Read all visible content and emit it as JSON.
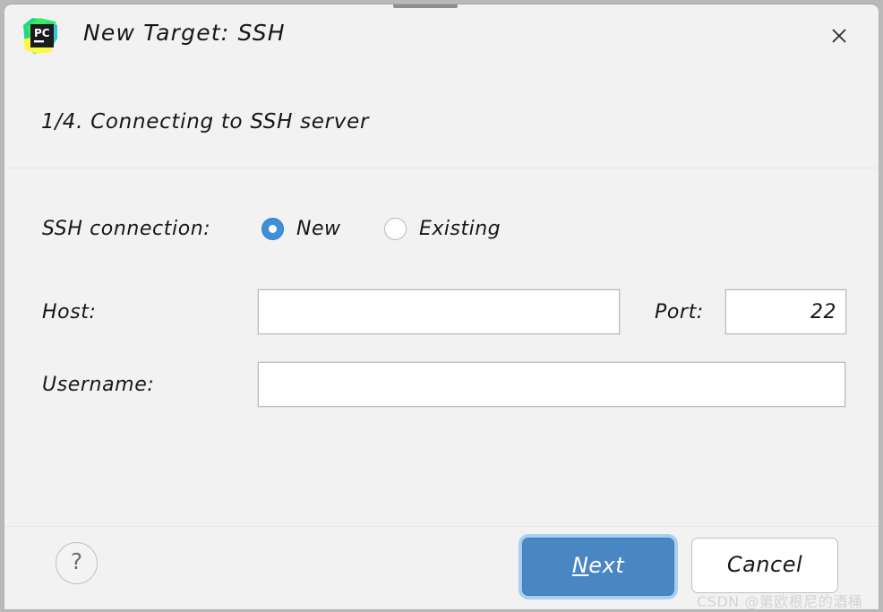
{
  "window": {
    "title": "New Target: SSH",
    "app_icon": "pycharm-icon",
    "close_icon": "close-icon"
  },
  "step": {
    "text": "1/4. Connecting to SSH server"
  },
  "form": {
    "connection": {
      "label": "SSH connection:",
      "options": [
        {
          "label": "New",
          "selected": true
        },
        {
          "label": "Existing",
          "selected": false
        }
      ]
    },
    "host": {
      "label": "Host:",
      "value": "",
      "placeholder": ""
    },
    "port": {
      "label": "Port:",
      "value": "22",
      "placeholder": ""
    },
    "username": {
      "label": "Username:",
      "value": "",
      "placeholder": ""
    }
  },
  "footer": {
    "help_label": "?",
    "next_label_mnemonic": "N",
    "next_label_rest": "ext",
    "cancel_label": "Cancel"
  },
  "watermark": {
    "text": "CSDN @第欧根尼的酒桶"
  },
  "colors": {
    "accent_blue": "#3f90d8",
    "primary_button": "#4b86c4",
    "focus_ring": "#a9cff0",
    "dialog_bg": "#f2f2f3",
    "field_bg": "#ffffff",
    "text": "#17171a"
  }
}
